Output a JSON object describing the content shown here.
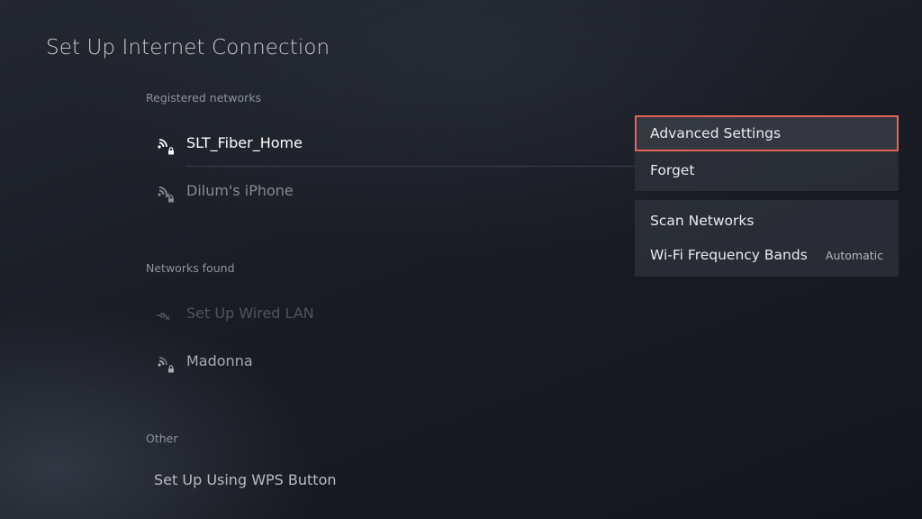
{
  "page": {
    "title": "Set Up Internet Connection"
  },
  "sections": {
    "registered": {
      "heading": "Registered networks",
      "items": [
        {
          "label": "SLT_Fiber_Home",
          "icon": "wifi-locked-icon",
          "state": "selected"
        },
        {
          "label": "Dilum's iPhone",
          "icon": "wifi-disconnected-locked-icon",
          "state": "dim"
        }
      ]
    },
    "found": {
      "heading": "Networks found",
      "items": [
        {
          "label": "Set Up Wired LAN",
          "icon": "ethernet-disconnected-icon",
          "state": "disabled"
        },
        {
          "label": "Madonna",
          "icon": "wifi-locked-icon",
          "state": "normal"
        }
      ]
    },
    "other": {
      "heading": "Other",
      "items": [
        {
          "label": "Set Up Using WPS Button"
        }
      ]
    }
  },
  "options_menu": {
    "group1": [
      {
        "label": "Advanced Settings",
        "focused": true
      },
      {
        "label": "Forget"
      }
    ],
    "group2": [
      {
        "label": "Scan Networks"
      },
      {
        "label": "Wi-Fi Frequency Bands",
        "value": "Automatic"
      }
    ]
  },
  "colors": {
    "focus_border": "#e2635c",
    "background": "#1b1e25",
    "text_primary": "#ffffff",
    "text_muted": "#8e939c"
  }
}
